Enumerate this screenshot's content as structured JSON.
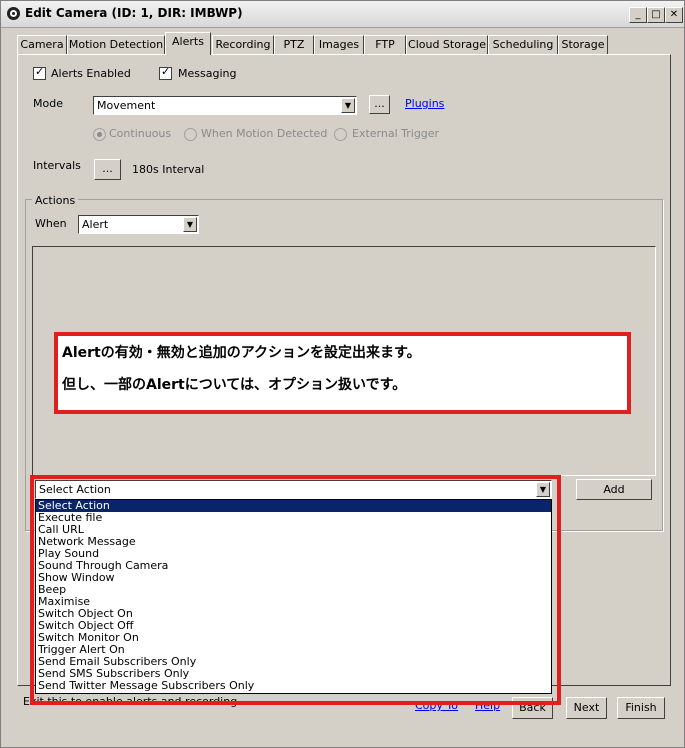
{
  "window": {
    "title": "Edit Camera (ID: 1, DIR: IMBWP)",
    "controls": {
      "minimize": "_",
      "maximize": "□",
      "close": "✕"
    }
  },
  "tabs": [
    {
      "label": "Camera"
    },
    {
      "label": "Motion Detection"
    },
    {
      "label": "Alerts"
    },
    {
      "label": "Recording"
    },
    {
      "label": "PTZ"
    },
    {
      "label": "Images"
    },
    {
      "label": "FTP"
    },
    {
      "label": "Cloud Storage"
    },
    {
      "label": "Scheduling"
    },
    {
      "label": "Storage"
    }
  ],
  "alerts": {
    "alerts_enabled_label": "Alerts Enabled",
    "alerts_enabled_checked": true,
    "messaging_label": "Messaging",
    "messaging_checked": true,
    "mode_label": "Mode",
    "mode_value": "Movement",
    "mode_button": "...",
    "plugins_link": "Plugins",
    "radios": [
      {
        "label": "Continuous",
        "selected": true
      },
      {
        "label": "When Motion Detected",
        "selected": false
      },
      {
        "label": "External Trigger",
        "selected": false
      }
    ],
    "intervals_label": "Intervals",
    "intervals_button": "...",
    "intervals_value": "180s Interval"
  },
  "actions": {
    "group_label": "Actions",
    "when_label": "When",
    "when_value": "Alert",
    "select_value": "Select Action",
    "add_button": "Add",
    "options": [
      "Select Action",
      "Execute file",
      "Call URL",
      "Network Message",
      "Play Sound",
      "Sound Through Camera",
      "Show Window",
      "Beep",
      "Maximise",
      "Switch Object On",
      "Switch Object Off",
      "Switch Monitor On",
      "Trigger Alert On",
      "Send Email Subscribers Only",
      "Send SMS Subscribers Only",
      "Send Twitter Message Subscribers Only"
    ],
    "highlighted_index": 0
  },
  "callout": {
    "line1": "Alertの有効・無効と追加のアクションを設定出来ます。",
    "line2": "但し、一部のAlertについては、オプション扱いです。"
  },
  "footer": {
    "status_text": "Exit this to enable alerts and recording",
    "copy_to_link": "Copy To",
    "help_link": "Help",
    "back_button": "Back",
    "next_button": "Next",
    "finish_button": "Finish"
  },
  "colors": {
    "callout_border": "#e02020",
    "highlight": "#0a246a",
    "link": "#0000ee"
  }
}
